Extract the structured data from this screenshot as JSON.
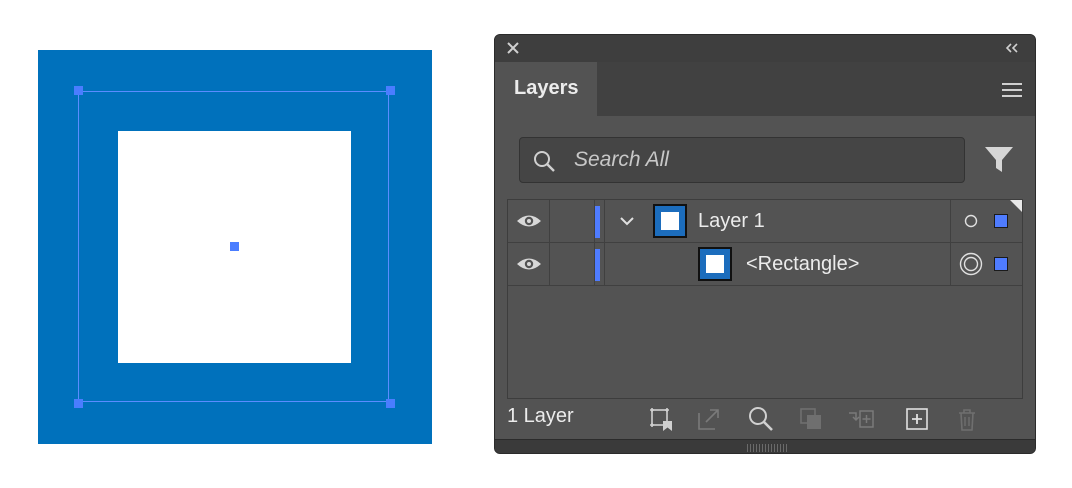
{
  "canvas": {
    "artwork_name": "<Rectangle>",
    "fill_color": "#0071BC",
    "inner_color": "#FFFFFF",
    "selection_color": "#4A7DFF"
  },
  "panel": {
    "tab_label": "Layers",
    "close_icon": "close-icon",
    "collapse_icon": "double-chevron-left-icon",
    "menu_icon": "hamburger-menu-icon",
    "search": {
      "placeholder": "Search All",
      "value": ""
    },
    "filter_icon": "filter-funnel-icon",
    "rows": [
      {
        "name": "Layer 1",
        "visible": true,
        "expanded": true,
        "layer_color": "#4F7CFF",
        "target": "hollow-circle",
        "selected": true
      },
      {
        "name": "<Rectangle>",
        "visible": true,
        "layer_color": "#4F7CFF",
        "target": "double-circle",
        "selected": true
      }
    ],
    "footer": {
      "count_label": "1 Layer",
      "buttons": [
        {
          "icon": "collect-for-export-icon"
        },
        {
          "icon": "export-arrow-icon"
        },
        {
          "icon": "locate-object-icon"
        },
        {
          "icon": "make-clipping-mask-icon"
        },
        {
          "icon": "create-sublayer-icon"
        },
        {
          "icon": "create-new-layer-icon"
        },
        {
          "icon": "delete-trash-icon"
        }
      ]
    },
    "colors": {
      "panel_bg": "#535353",
      "header_bg": "#3E3E3E",
      "text": "#ECECEC",
      "accent": "#4F7CFF"
    }
  }
}
